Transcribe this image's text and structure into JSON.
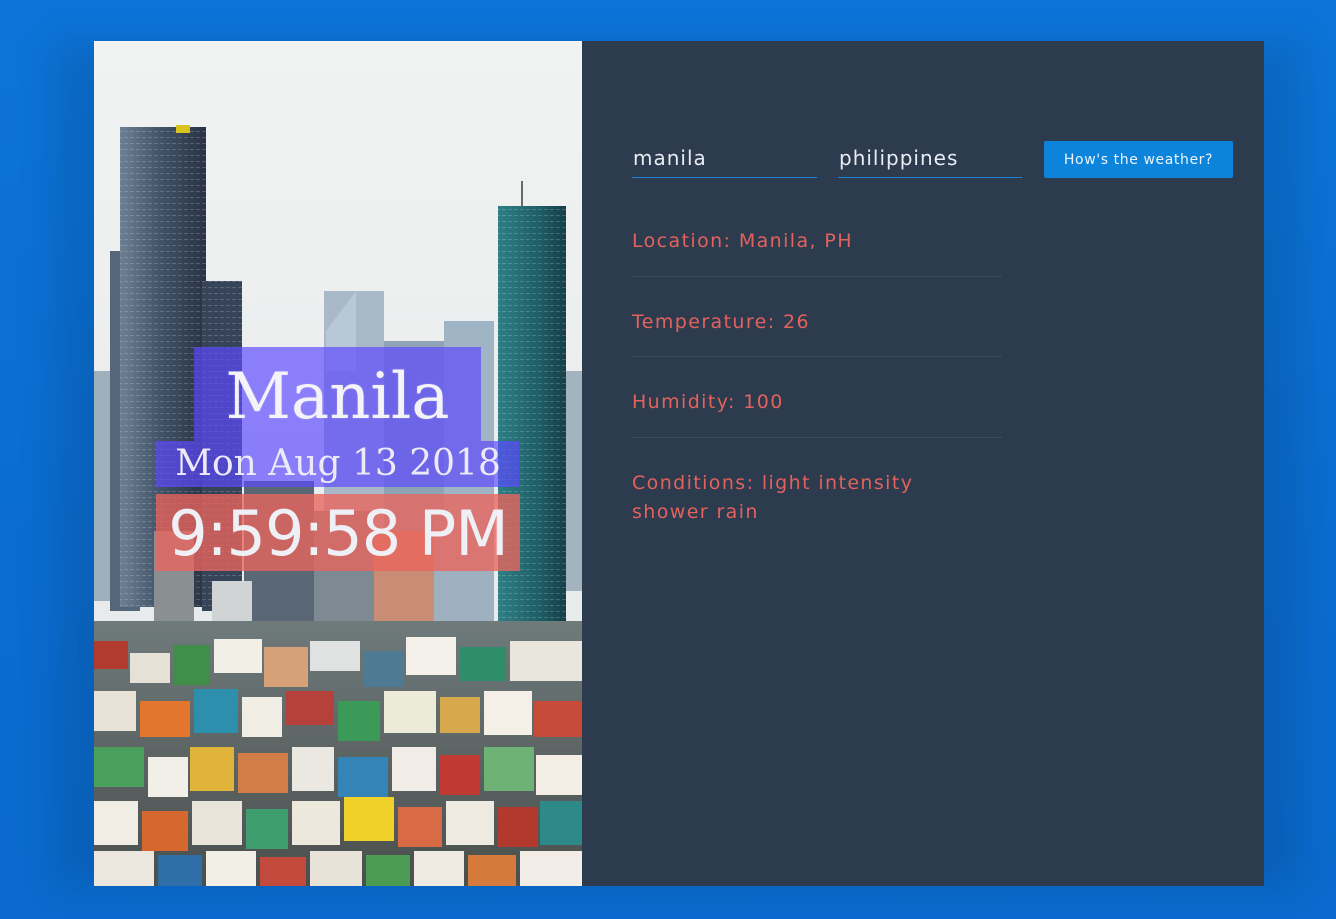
{
  "form": {
    "city_value": "manila",
    "country_value": "philippines",
    "submit_label": "How's the weather?"
  },
  "clock": {
    "city": "Manila",
    "date": "Mon Aug 13 2018",
    "time": "9:59:58 PM"
  },
  "weather": {
    "location_label": "Location:",
    "location_value": "Manila, PH",
    "temperature_label": "Temperature:",
    "temperature_value": "26",
    "humidity_label": "Humidity:",
    "humidity_value": "100",
    "conditions_label": "Conditions:",
    "conditions_value": "light intensity shower rain"
  },
  "colors": {
    "background": "#0a6fd4",
    "card": "#2d3b4e",
    "accent": "#0d84dc",
    "result_text": "#e3625c",
    "city_overlay": "#5c48ff",
    "time_overlay": "#eb645c"
  }
}
